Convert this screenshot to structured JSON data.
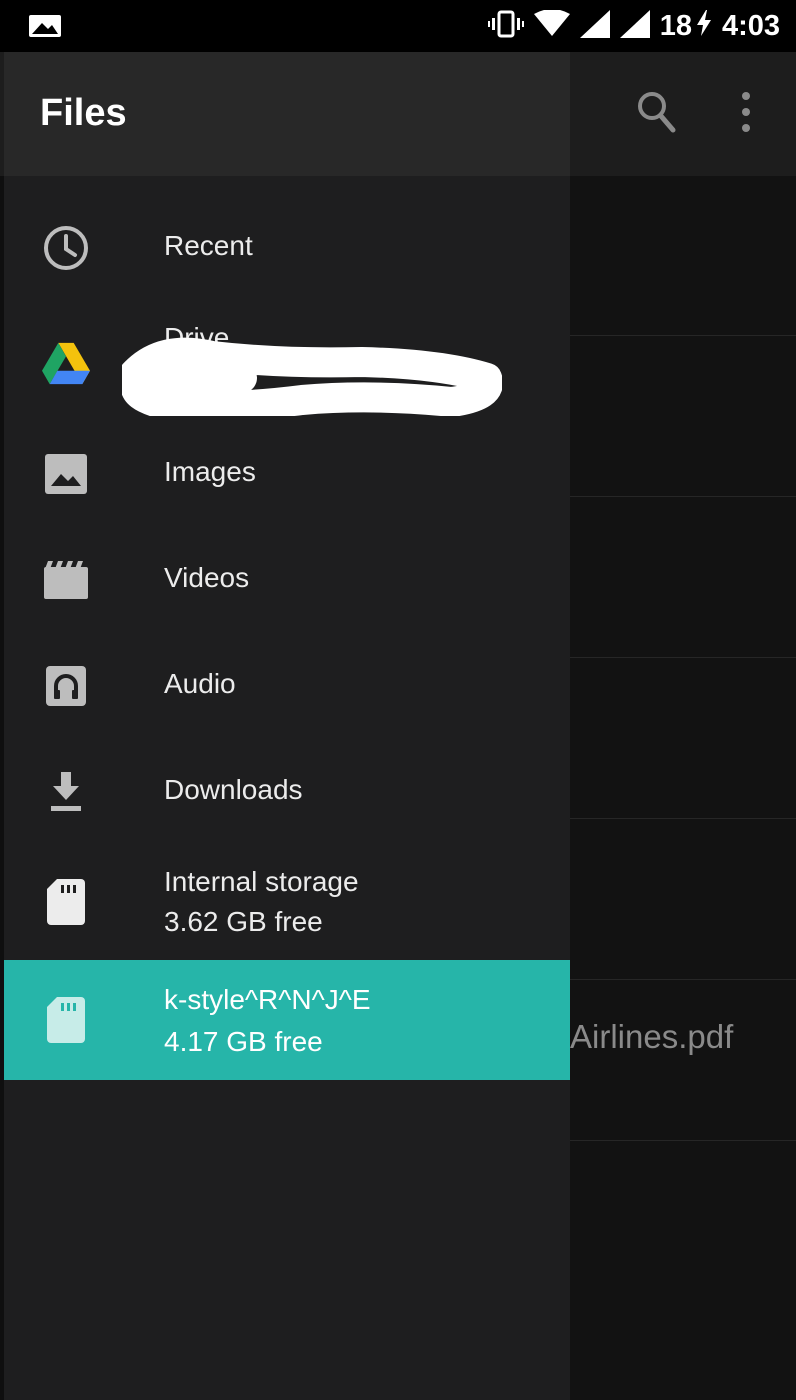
{
  "status_bar": {
    "signal_count": "18",
    "time": "4:03",
    "icons": [
      "photo-notification-icon",
      "vibrate-icon",
      "wifi-icon",
      "cell-signal-icon",
      "cell-signal-icon",
      "battery-charging-icon"
    ]
  },
  "toolbar": {
    "icons": [
      "search-icon",
      "more-vert-icon"
    ]
  },
  "drawer": {
    "title": "Files",
    "items": [
      {
        "label": "Recent",
        "icon": "clock-icon"
      },
      {
        "label": "Drive",
        "icon": "google-drive-icon"
      },
      {
        "label": "Images",
        "icon": "image-icon"
      },
      {
        "label": "Videos",
        "icon": "video-icon"
      },
      {
        "label": "Audio",
        "icon": "audio-icon"
      },
      {
        "label": "Downloads",
        "icon": "download-icon"
      },
      {
        "label": "Internal storage",
        "sub": "3.62 GB free",
        "icon": "sd-card-icon"
      },
      {
        "label": "k-style^R^N^J^E",
        "sub": "4.17 GB free",
        "icon": "sd-card-icon",
        "selected": true
      }
    ]
  },
  "background_list": {
    "visible_file": "Airlines.pdf"
  },
  "colors": {
    "accent": "#26b5a9",
    "drawer_bg": "#1e1e1f",
    "header_bg": "#282828"
  }
}
